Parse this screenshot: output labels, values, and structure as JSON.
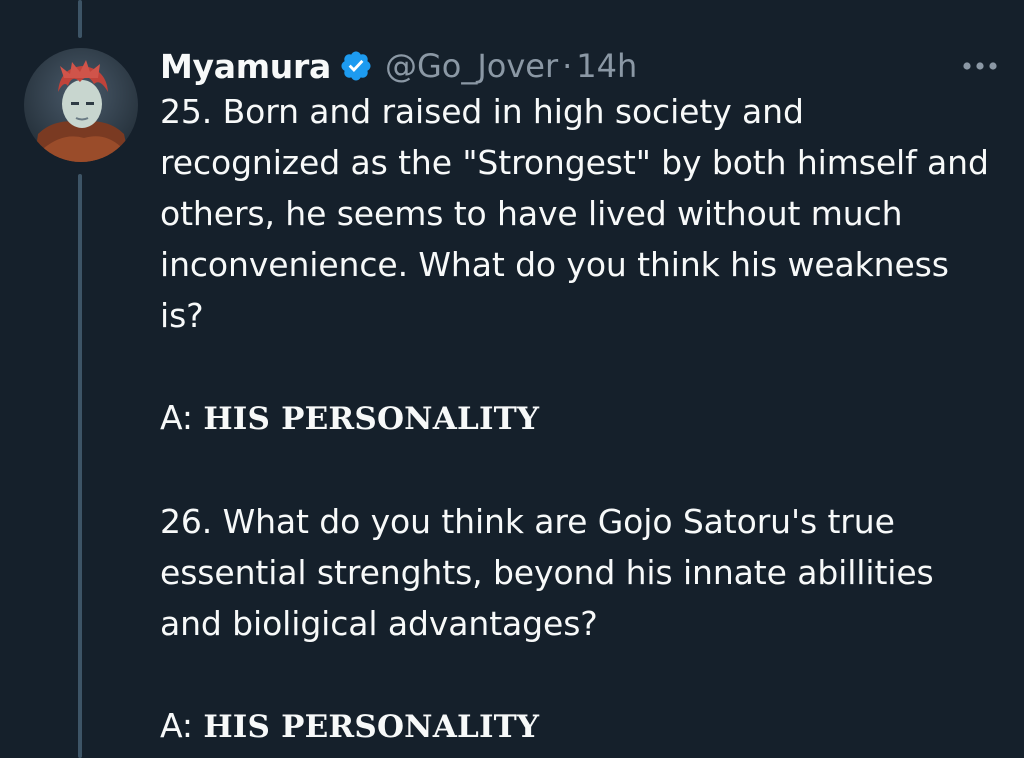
{
  "tweet": {
    "display_name": "Myamura",
    "handle": "@Go_Jover",
    "separator": "·",
    "time": "14h",
    "verified_icon": "verified-badge-icon",
    "more_icon": "more-options-icon",
    "paragraphs": [
      "25. Born and raised in high society and recognized as the \"Strongest\" by both himself and others, he seems to have lived without much inconvenience. What do you think his weakness is?",
      "26. What do you think are Gojo Satoru's true essential strenghts, beyond his innate abillities and bioligical advantages?"
    ],
    "answers": [
      {
        "prefix": "A: ",
        "text": "HIS PERSONALITY"
      },
      {
        "prefix": "A: ",
        "text": "HIS PERSONALITY"
      }
    ]
  },
  "colors": {
    "background": "#15202b",
    "text": "#f7f9f9",
    "secondary_text": "#8b98a5",
    "verified": "#1d9bf0",
    "thread_line": "#3d5466"
  }
}
